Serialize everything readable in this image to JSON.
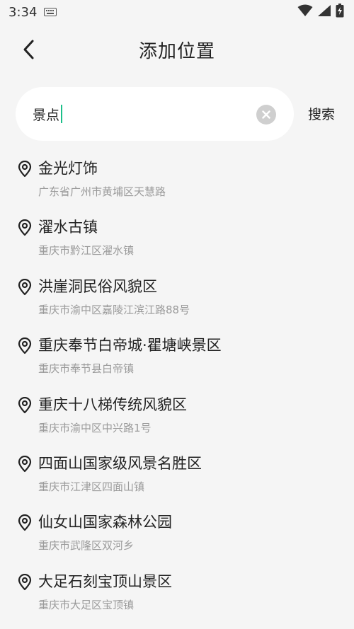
{
  "status_bar": {
    "time": "3:34",
    "icons": [
      "keyboard-icon",
      "wifi-icon",
      "signal-icon",
      "battery-charging-icon"
    ]
  },
  "header": {
    "title": "添加位置",
    "back_icon": "chevron-left-icon"
  },
  "search": {
    "value": "景点",
    "clear_icon": "clear-icon",
    "button_label": "搜索",
    "accent": "#1dbf8a"
  },
  "results": [
    {
      "name": "金光灯饰",
      "address": "广东省广州市黄埔区天慧路"
    },
    {
      "name": "濯水古镇",
      "address": "重庆市黔江区濯水镇"
    },
    {
      "name": "洪崖洞民俗风貌区",
      "address": "重庆市渝中区嘉陵江滨江路88号"
    },
    {
      "name": "重庆奉节白帝城·瞿塘峡景区",
      "address": "重庆市奉节县白帝镇"
    },
    {
      "name": "重庆十八梯传统风貌区",
      "address": "重庆市渝中区中兴路1号"
    },
    {
      "name": "四面山国家级风景名胜区",
      "address": "重庆市江津区四面山镇"
    },
    {
      "name": "仙女山国家森林公园",
      "address": "重庆市武隆区双河乡"
    },
    {
      "name": "大足石刻宝顶山景区",
      "address": "重庆市大足区宝顶镇"
    }
  ]
}
